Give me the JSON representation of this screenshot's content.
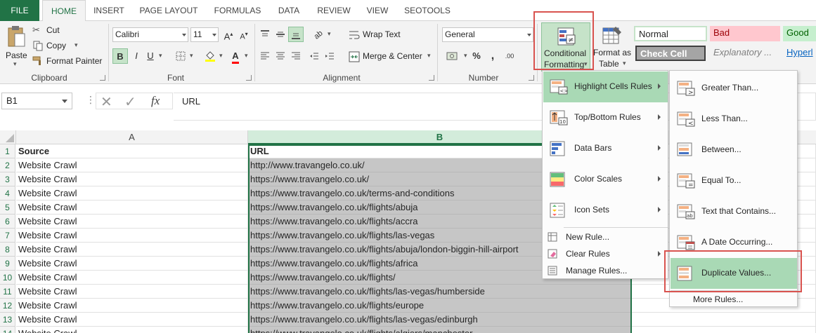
{
  "tabs": [
    "FILE",
    "HOME",
    "INSERT",
    "PAGE LAYOUT",
    "FORMULAS",
    "DATA",
    "REVIEW",
    "VIEW",
    "SEOTOOLS"
  ],
  "clipboard": {
    "paste": "Paste",
    "cut": "Cut",
    "copy": "Copy",
    "format_painter": "Format Painter",
    "label": "Clipboard"
  },
  "font": {
    "name": "Calibri",
    "size": "11",
    "bold": "B",
    "italic": "I",
    "underline": "U",
    "label": "Font"
  },
  "alignment": {
    "wrap_text": "Wrap Text",
    "merge_center": "Merge & Center",
    "label": "Alignment"
  },
  "number": {
    "format": "General",
    "percent": "%",
    "comma": ",",
    "inc_dec": ".00",
    "label": "Number"
  },
  "styles": {
    "conditional_formatting_1": "Conditional",
    "conditional_formatting_2": "Formatting",
    "format_table_1": "Format as",
    "format_table_2": "Table",
    "normal": "Normal",
    "bad": "Bad",
    "good": "Good",
    "check_cell": "Check Cell",
    "explanatory": "Explanatory ...",
    "hyperlink": "Hyperl"
  },
  "colors": {
    "excel_green": "#217346",
    "bad_bg": "#ffc7ce",
    "good_bg": "#c6efce",
    "highlight": "#a9d9b5",
    "red_box": "#d9534f"
  },
  "formula_bar": {
    "name_box": "B1",
    "content": "URL"
  },
  "columns": [
    "A",
    "B"
  ],
  "rows": [
    {
      "n": "1",
      "a": "Source",
      "b": "URL"
    },
    {
      "n": "2",
      "a": "Website Crawl",
      "b": "http://www.travangelo.co.uk/"
    },
    {
      "n": "3",
      "a": "Website Crawl",
      "b": "https://www.travangelo.co.uk/"
    },
    {
      "n": "4",
      "a": "Website Crawl",
      "b": "https://www.travangelo.co.uk/terms-and-conditions"
    },
    {
      "n": "5",
      "a": "Website Crawl",
      "b": "https://www.travangelo.co.uk/flights/abuja"
    },
    {
      "n": "6",
      "a": "Website Crawl",
      "b": "https://www.travangelo.co.uk/flights/accra"
    },
    {
      "n": "7",
      "a": "Website Crawl",
      "b": "https://www.travangelo.co.uk/flights/las-vegas"
    },
    {
      "n": "8",
      "a": "Website Crawl",
      "b": "https://www.travangelo.co.uk/flights/abuja/london-biggin-hill-airport"
    },
    {
      "n": "9",
      "a": "Website Crawl",
      "b": "https://www.travangelo.co.uk/flights/africa"
    },
    {
      "n": "10",
      "a": "Website Crawl",
      "b": "https://www.travangelo.co.uk/flights/"
    },
    {
      "n": "11",
      "a": "Website Crawl",
      "b": "https://www.travangelo.co.uk/flights/las-vegas/humberside"
    },
    {
      "n": "12",
      "a": "Website Crawl",
      "b": "https://www.travangelo.co.uk/flights/europe"
    },
    {
      "n": "13",
      "a": "Website Crawl",
      "b": "https://www.travangelo.co.uk/flights/las-vegas/edinburgh"
    },
    {
      "n": "14",
      "a": "Website Crawl",
      "b": "https://www.travangelo.co.uk/flights/algiers/manchester"
    }
  ],
  "cf_menu": {
    "highlight_rules": "Highlight Cells Rules",
    "top_bottom": "Top/Bottom Rules",
    "data_bars": "Data Bars",
    "color_scales": "Color Scales",
    "icon_sets": "Icon Sets",
    "new_rule": "New Rule...",
    "clear_rules": "Clear Rules",
    "manage_rules": "Manage Rules..."
  },
  "highlight_menu": {
    "greater_than": "Greater Than...",
    "less_than": "Less Than...",
    "between": "Between...",
    "equal_to": "Equal To...",
    "text_contains": "Text that Contains...",
    "date_occurring": "A Date Occurring...",
    "duplicate_values": "Duplicate Values...",
    "more_rules": "More Rules..."
  }
}
